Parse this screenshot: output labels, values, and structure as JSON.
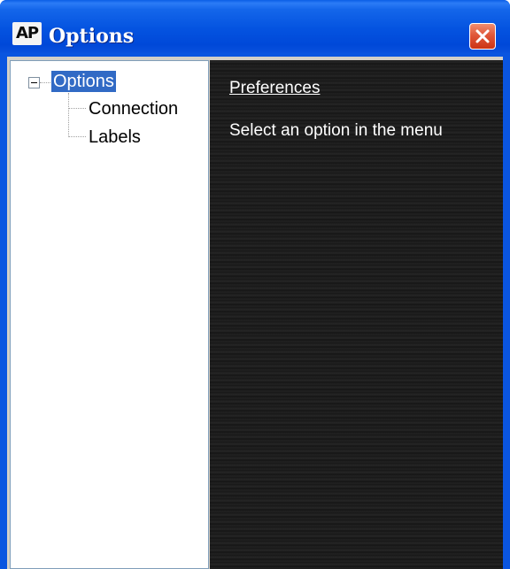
{
  "window": {
    "title": "Options",
    "app_icon_text": "AP",
    "title_color": "#0054e3",
    "close_color": "#e0573a"
  },
  "tree": {
    "root": {
      "label": "Options",
      "expanded": true,
      "selected": true
    },
    "children": [
      {
        "label": "Connection"
      },
      {
        "label": "Labels"
      }
    ],
    "selection_color": "#316ac5"
  },
  "content": {
    "heading": "Preferences",
    "message": "Select an option in the menu",
    "background_color": "#1c1c1c"
  },
  "icons": {
    "app": "ap-logo-icon",
    "close": "close-icon",
    "expander": "collapse-minus-icon"
  }
}
